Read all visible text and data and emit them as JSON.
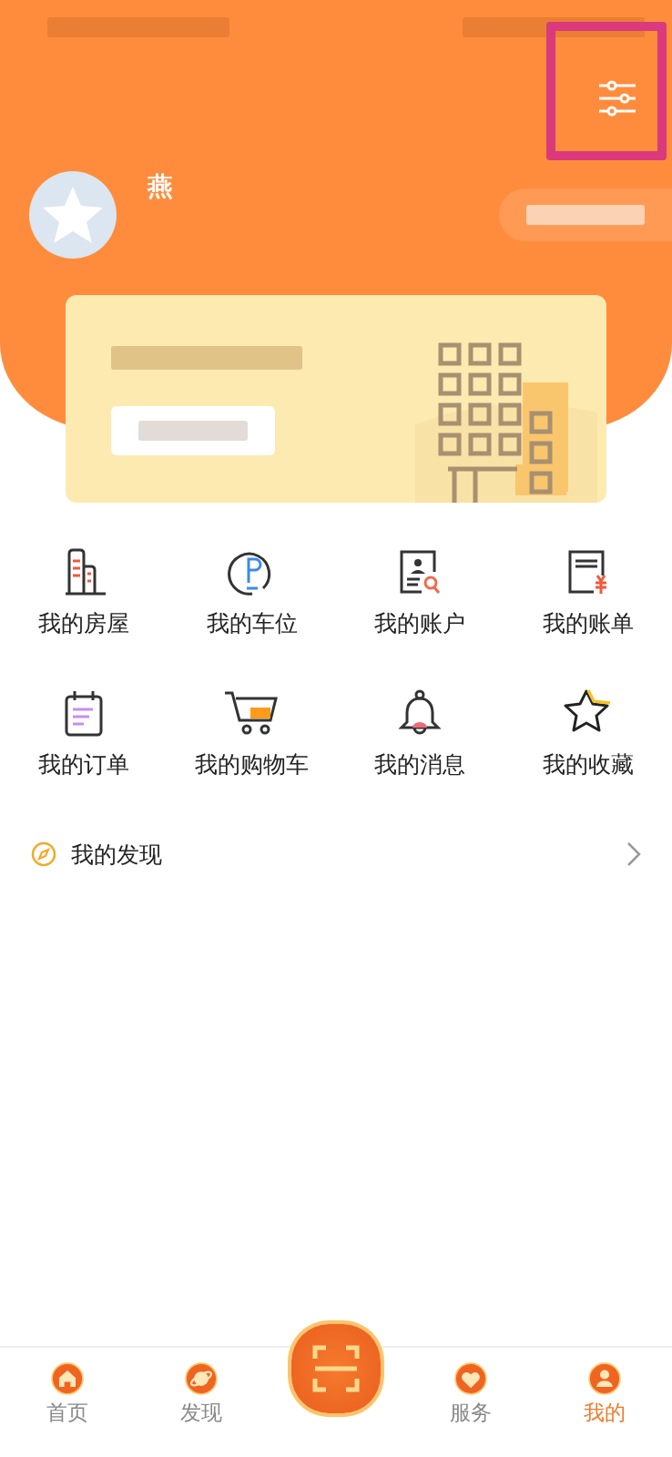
{
  "profile": {
    "name": "燕"
  },
  "features": [
    {
      "label": "我的房屋"
    },
    {
      "label": "我的车位"
    },
    {
      "label": "我的账户"
    },
    {
      "label": "我的账单"
    },
    {
      "label": "我的订单"
    },
    {
      "label": "我的购物车"
    },
    {
      "label": "我的消息"
    },
    {
      "label": "我的收藏"
    }
  ],
  "discover": {
    "label": "我的发现"
  },
  "tabs": [
    {
      "label": "首页",
      "selected": false,
      "kind": "tab"
    },
    {
      "label": "发现",
      "selected": false,
      "kind": "tab"
    },
    {
      "kind": "scan",
      "selected": false
    },
    {
      "label": "服务",
      "selected": false,
      "kind": "tab"
    },
    {
      "label": "我的",
      "selected": true,
      "kind": "tab"
    }
  ]
}
